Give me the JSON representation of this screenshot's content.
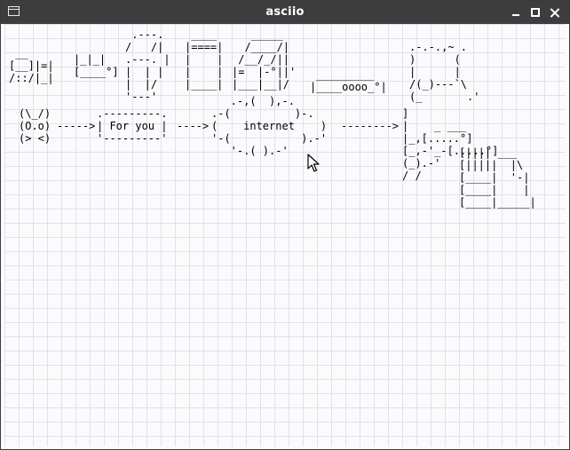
{
  "window": {
    "title": "asciio"
  },
  "canvas": {
    "grid_color": "#dfe2ea",
    "background_color": "#fbfbfd"
  },
  "objects": {
    "cabinet": " __\n[__]|=|\n/::/|_|",
    "mailbox": "|_|_|\n[____°]",
    "tall_box": " .---.\n/   /|\n.---. |\n|  | |\n|  |/\n'---'",
    "monitor": " ____\n|====|\n|    |\n|    |\n|____|",
    "computer": "   _____\n  /____/|\n /__/_/||\n|=  |-°||'\n|___|__|/",
    "device": " _________\n|____oooo_°|",
    "printer": ".-.-.,~ .\n)      (\n|      |\n/(_)---`\\\n(_       .'",
    "face": "(\\_/)\n(O.o)\n(> <)",
    "for_you_box": ".---------.\n| For you |\n'---------'",
    "arrow_to_box": "----->",
    "arrow_to_cloud": "---->",
    "internet_cloud": "   .-,(  ),-.\n.-(          )-.\n(    internet    )\n'-(           ).-'\n   '-.( ).-'",
    "arrow_from_cloud": "-------->",
    "server": "]\n|    _ ___\n|_,[.....°]\n[_,-'_-[.....°]\n(_).-'\n/ /",
    "keyboard_stack": "[|||| ___\n[|||||  |\\\n[____|  '-|\n[____|    |\n[____|_____|"
  }
}
